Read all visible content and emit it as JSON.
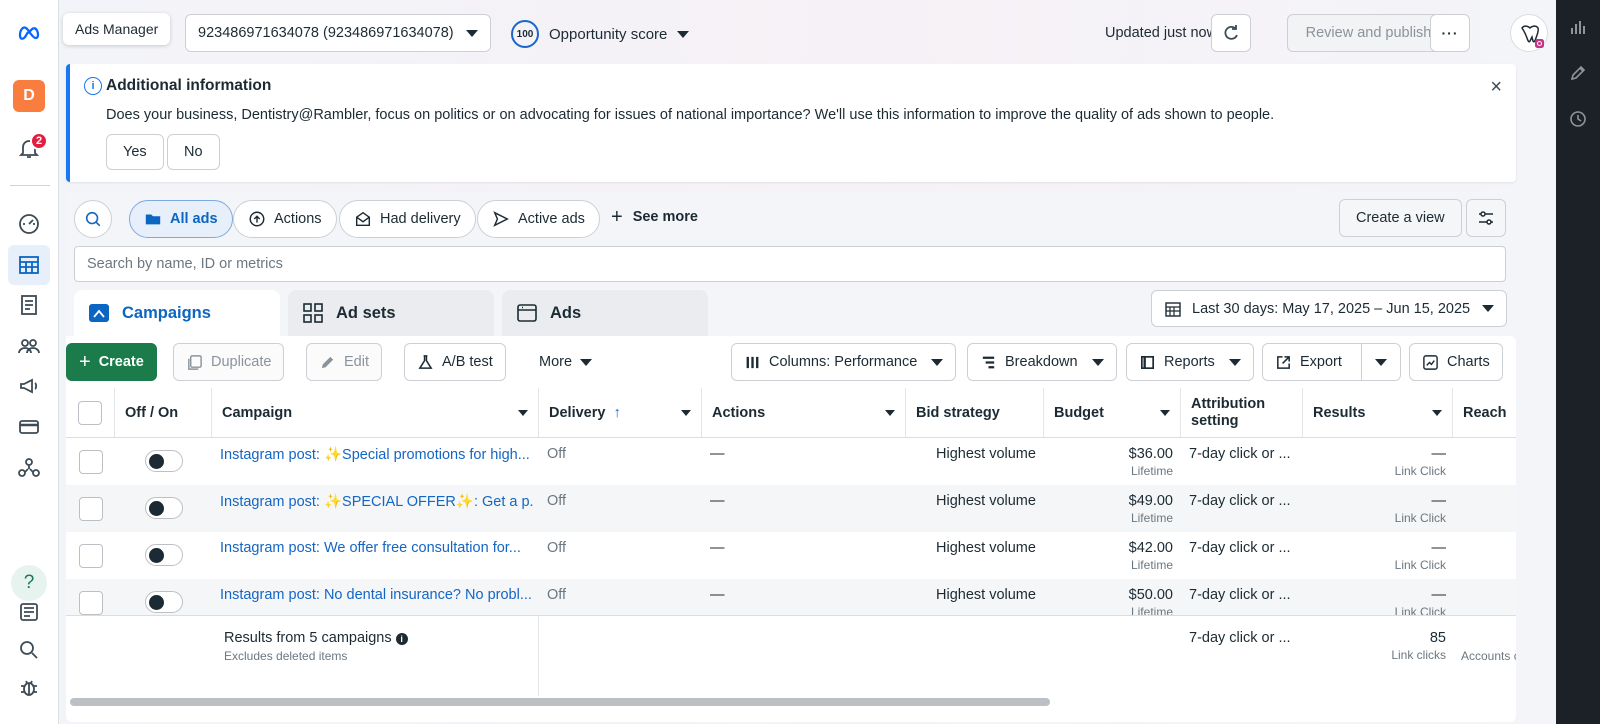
{
  "topbar": {
    "app_name": "Ads Manager",
    "account": "923486971634078 (923486971634078)",
    "opportunity_score_value": "100",
    "opportunity_score_label": "Opportunity score",
    "updated_text": "Updated just now",
    "review_publish_label": "Review and publish",
    "more_label": "···"
  },
  "left_rail": {
    "account_initial": "D",
    "notification_count": "2",
    "help_label": "?"
  },
  "banner": {
    "title": "Additional information",
    "message": "Does your business, Dentistry@Rambler, focus on politics or on advocating for issues of national importance? We'll use this information to improve the quality of ads shown to people.",
    "yes_label": "Yes",
    "no_label": "No",
    "info_glyph": "i",
    "close_glyph": "×"
  },
  "filters": {
    "pills": [
      "All ads",
      "Actions",
      "Had delivery",
      "Active ads"
    ],
    "see_more": "See more",
    "create_view": "Create a view",
    "search_placeholder": "Search by name, ID or metrics"
  },
  "tabs": [
    "Campaigns",
    "Ad sets",
    "Ads"
  ],
  "date_range": "Last 30 days: May 17, 2025 – Jun 15, 2025",
  "toolbar": {
    "create": "Create",
    "duplicate": "Duplicate",
    "edit": "Edit",
    "ab_test": "A/B test",
    "more": "More",
    "columns": "Columns: Performance",
    "breakdown": "Breakdown",
    "reports": "Reports",
    "export": "Export",
    "charts": "Charts"
  },
  "table": {
    "headers": [
      "Off / On",
      "Campaign",
      "Delivery",
      "Actions",
      "Bid strategy",
      "Budget",
      "Attribution setting",
      "Results",
      "Reach"
    ],
    "rows": [
      {
        "campaign": "Instagram post: ✨Special promotions for high...",
        "delivery": "Off",
        "actions": "—",
        "bid": "Highest volume",
        "budget": "$36.00",
        "budget_type": "Lifetime",
        "attribution": "7-day click or ...",
        "results": "—",
        "results_type": "Link Click"
      },
      {
        "campaign": "Instagram post: ✨SPECIAL OFFER✨: Get a p...",
        "delivery": "Off",
        "actions": "—",
        "bid": "Highest volume",
        "budget": "$49.00",
        "budget_type": "Lifetime",
        "attribution": "7-day click or ...",
        "results": "—",
        "results_type": "Link Click"
      },
      {
        "campaign": "Instagram post: We offer free consultation for...",
        "delivery": "Off",
        "actions": "—",
        "bid": "Highest volume",
        "budget": "$42.00",
        "budget_type": "Lifetime",
        "attribution": "7-day click or ...",
        "results": "—",
        "results_type": "Link Click"
      },
      {
        "campaign": "Instagram post: No dental insurance? No probl...",
        "delivery": "Off",
        "actions": "—",
        "bid": "Highest volume",
        "budget": "$50.00",
        "budget_type": "Lifetime",
        "attribution": "7-day click or ...",
        "results": "—",
        "results_type": "Link Click"
      }
    ],
    "footer": {
      "summary": "Results from 5 campaigns",
      "note": "Excludes deleted items",
      "attribution": "7-day click or ...",
      "results": "85",
      "results_type": "Link clicks",
      "reach_note": "Accounts c"
    }
  }
}
